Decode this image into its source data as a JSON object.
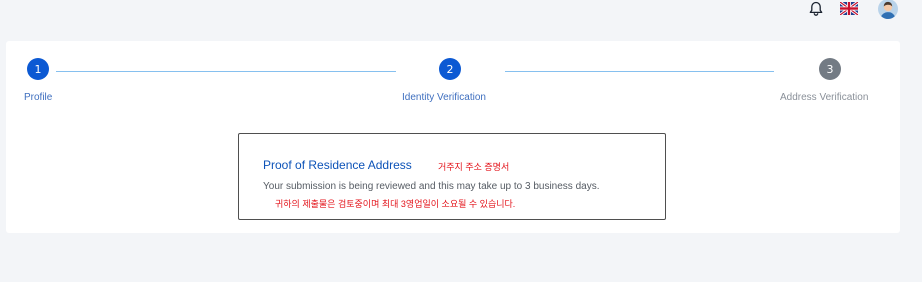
{
  "header": {
    "icons": {
      "bell": "bell-icon",
      "flag": "uk-flag-icon",
      "avatar": "user-avatar-icon"
    }
  },
  "stepper": {
    "steps": [
      {
        "number": "1",
        "label": "Profile",
        "status": "active"
      },
      {
        "number": "2",
        "label": "Identity Verification",
        "status": "active"
      },
      {
        "number": "3",
        "label": "Address Verification",
        "status": "pending"
      }
    ],
    "colors": {
      "active": "#0c59d3",
      "pending": "#737b84",
      "line": "#86c0ef"
    }
  },
  "notice": {
    "title": "Proof of Residence Address",
    "title_ko": "거주지 주소 증명서",
    "message": "Your submission is being reviewed and this may take up to 3 business days.",
    "message_ko": "귀하의 제출물은 검토중이며 최대 3영업일이 소요될 수 있습니다."
  }
}
